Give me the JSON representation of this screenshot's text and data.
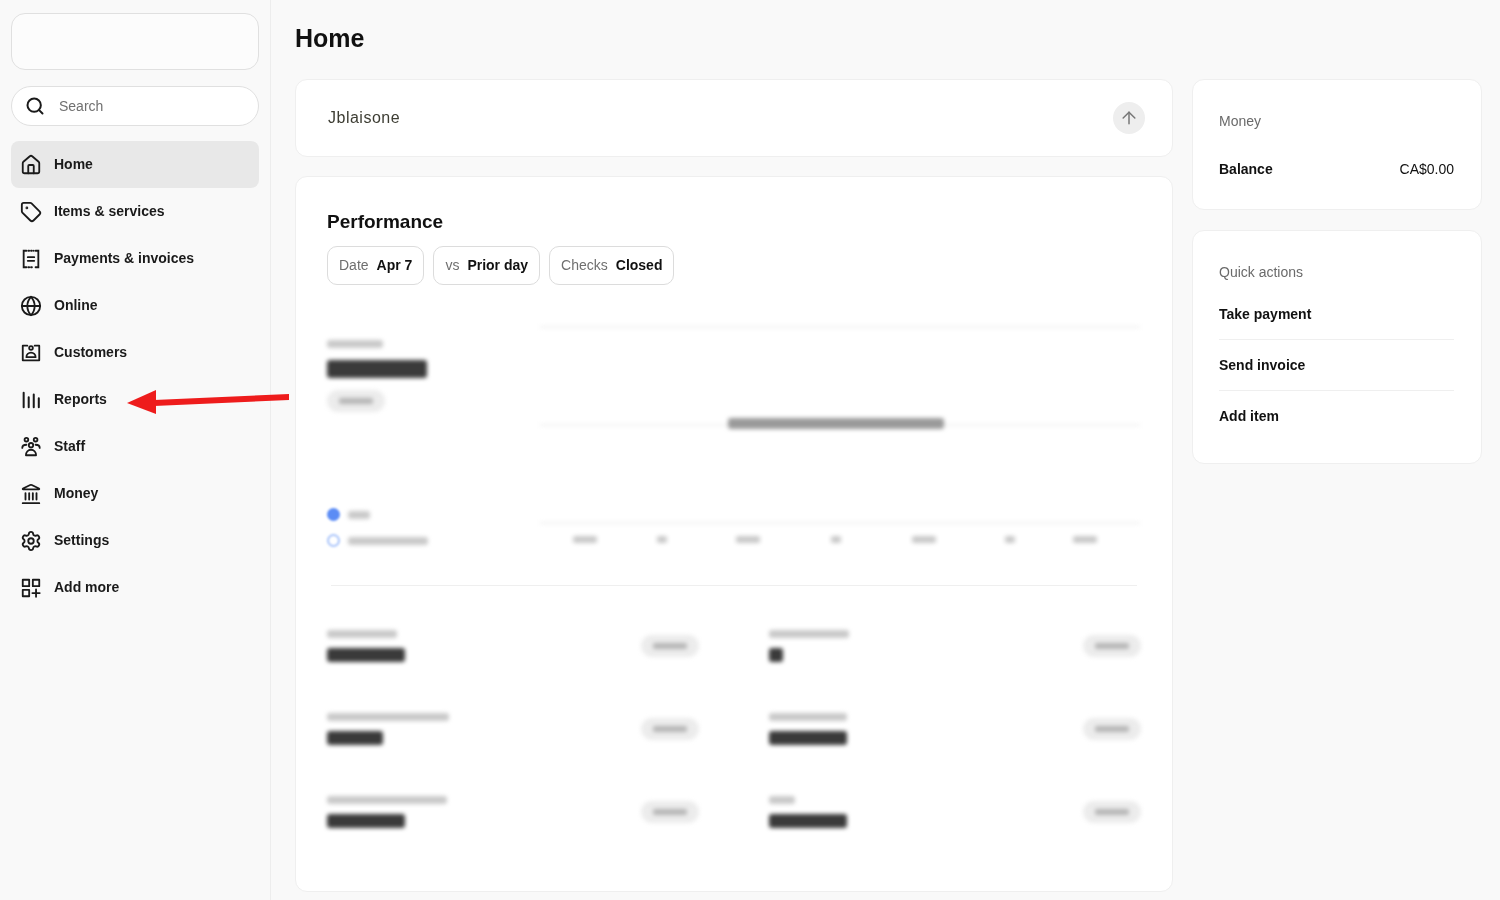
{
  "sidebar": {
    "search": {
      "placeholder": "Search"
    },
    "items": [
      {
        "label": "Home",
        "kind": "home",
        "selected": true
      },
      {
        "label": "Items & services",
        "kind": "tag",
        "selected": false
      },
      {
        "label": "Payments & invoices",
        "kind": "receipt",
        "selected": false
      },
      {
        "label": "Online",
        "kind": "globe",
        "selected": false
      },
      {
        "label": "Customers",
        "kind": "contact",
        "selected": false
      },
      {
        "label": "Reports",
        "kind": "bars",
        "selected": false
      },
      {
        "label": "Staff",
        "kind": "people",
        "selected": false
      },
      {
        "label": "Money",
        "kind": "bank",
        "selected": false
      },
      {
        "label": "Settings",
        "kind": "gear",
        "selected": false
      },
      {
        "label": "Add more",
        "kind": "grid-plus",
        "selected": false
      }
    ]
  },
  "page": {
    "title": "Home"
  },
  "business_card": {
    "name": "Jblaisone"
  },
  "performance": {
    "title": "Performance",
    "filters": [
      {
        "label": "Date",
        "value": "Apr 7"
      },
      {
        "label": "vs",
        "value": "Prior day"
      },
      {
        "label": "Checks",
        "value": "Closed"
      }
    ]
  },
  "money": {
    "title": "Money",
    "rows": [
      {
        "label": "Balance",
        "value": "CA$0.00"
      }
    ]
  },
  "quick_actions": {
    "title": "Quick actions",
    "items": [
      "Take payment",
      "Send invoice",
      "Add item"
    ]
  }
}
